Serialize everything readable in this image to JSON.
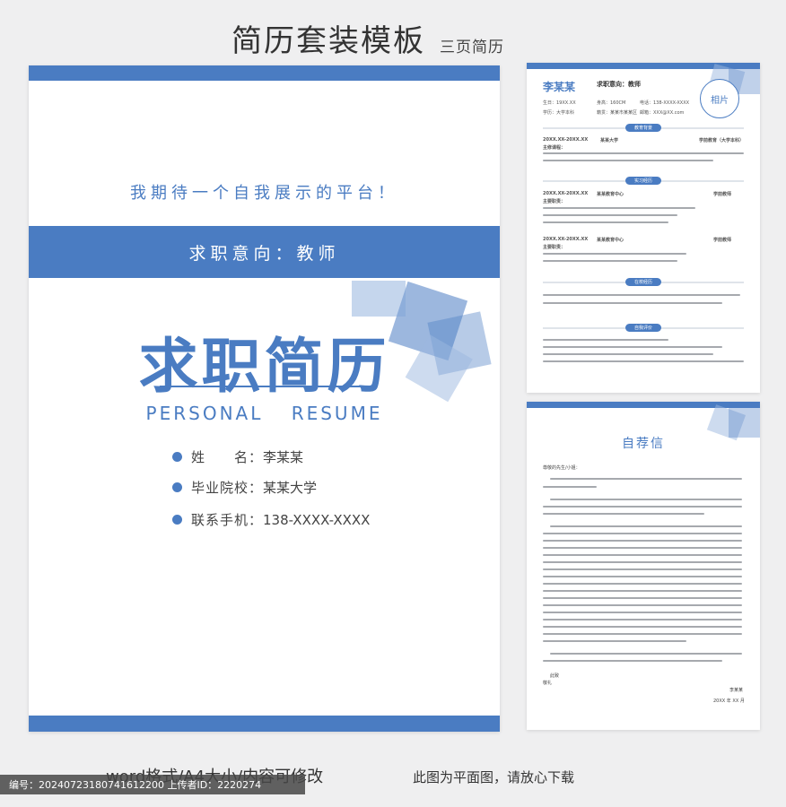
{
  "header": {
    "title": "简历套装模板",
    "subtitle": "三页简历"
  },
  "cover": {
    "slogan": "我期待一个自我展示的平台！",
    "intention": "求职意向：教师",
    "title": "求职简历",
    "english": "PERSONAL RESUME",
    "info": [
      {
        "label": "姓　　名：",
        "value": "李某某"
      },
      {
        "label": "毕业院校：",
        "value": "某某大学"
      },
      {
        "label": "联系手机：",
        "value": "138-XXXX-XXXX"
      }
    ]
  },
  "resume": {
    "name": "李某某",
    "intention": "求职意向：教师",
    "photo": "相片",
    "fields": [
      {
        "text": "生日：19XX.XX"
      },
      {
        "text": "身高：160CM"
      },
      {
        "text": "电话：138-XXXX-XXXX"
      },
      {
        "text": "学历：大学本科"
      },
      {
        "text": "籍贯：某某市某某区"
      },
      {
        "text": "邮箱：XXX@XX.com"
      }
    ],
    "sections": [
      "教育背景",
      "实习经历",
      "在校经历",
      "自我评价"
    ],
    "edu": {
      "date": "20XX.XX-20XX.XX",
      "school": "某某大学",
      "major": "学前教育（大学本科）",
      "label": "主修课程："
    },
    "jobs": [
      {
        "date": "20XX.XX-20XX.XX",
        "org": "某某教育中心",
        "role": "学前教师",
        "label": "主要职责："
      },
      {
        "date": "20XX.XX-20XX.XX",
        "org": "某某教育中心",
        "role": "学前教师",
        "label": "主要职责："
      }
    ]
  },
  "letter": {
    "title": "自荐信",
    "greeting": "尊敬的先生/小姐：",
    "closing1": "此致",
    "closing2": "敬礼",
    "sign": "李某某",
    "date": "20XX 年 XX 月"
  },
  "footer": {
    "left": "word格式/A4大小/内容可修改",
    "right": "此图为平面图，请放心下载",
    "id_text": "编号：20240723180741612200  上传者ID：2220274"
  },
  "colors": {
    "accent": "#4a7cc2",
    "background": "#efeff0"
  }
}
